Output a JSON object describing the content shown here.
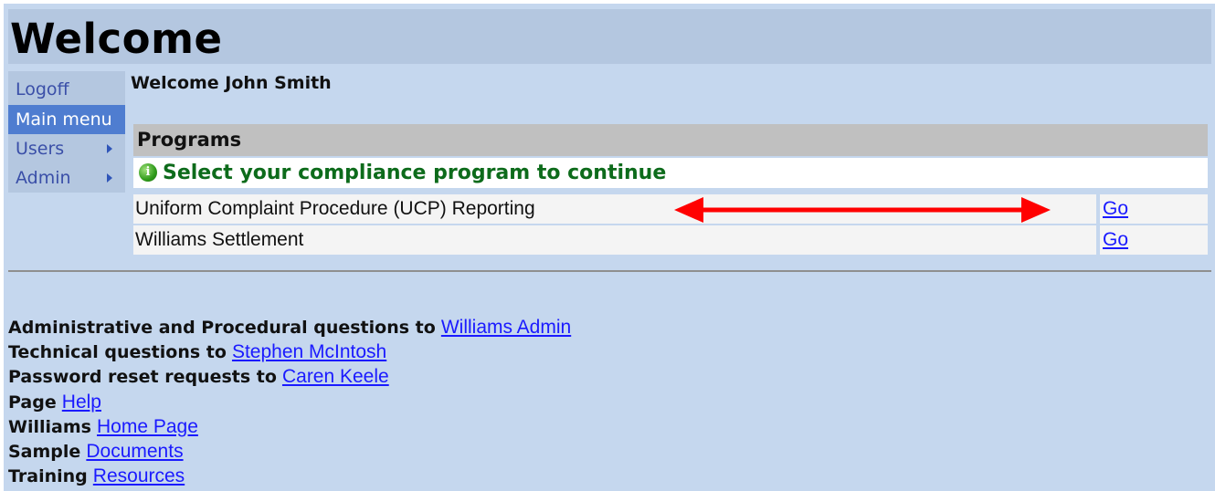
{
  "header": {
    "title": "Welcome"
  },
  "nav": {
    "items": [
      {
        "label": "Logoff"
      },
      {
        "label": "Main menu"
      },
      {
        "label": "Users"
      },
      {
        "label": "Admin"
      }
    ]
  },
  "welcome_user": "Welcome John Smith",
  "programs": {
    "heading": "Programs",
    "message": "Select your compliance program to continue",
    "rows": [
      {
        "name": "Uniform Complaint Procedure (UCP) Reporting",
        "link": "Go"
      },
      {
        "name": "Williams Settlement",
        "link": "Go"
      }
    ]
  },
  "contacts": [
    {
      "prefix": "Administrative and Procedural questions to",
      "link": "Williams Admin"
    },
    {
      "prefix": "Technical questions to",
      "link": "Stephen McIntosh"
    },
    {
      "prefix": "Password reset requests to",
      "link": "Caren Keele"
    },
    {
      "prefix": "Page",
      "link": "Help"
    },
    {
      "prefix": "Williams",
      "link": "Home Page"
    },
    {
      "prefix": "Sample",
      "link": "Documents"
    },
    {
      "prefix": "Training",
      "link": "Resources"
    }
  ],
  "colors": {
    "page_bg": "#c5d7ee",
    "header_bg": "#b4c7e0",
    "active_nav": "#4f7dd0",
    "message_green": "#0d6b1b",
    "arrow_red": "#ff0000",
    "link_blue": "#1a1aff"
  },
  "icons": {
    "message": "info-icon",
    "annotation": "double-headed-arrow"
  }
}
